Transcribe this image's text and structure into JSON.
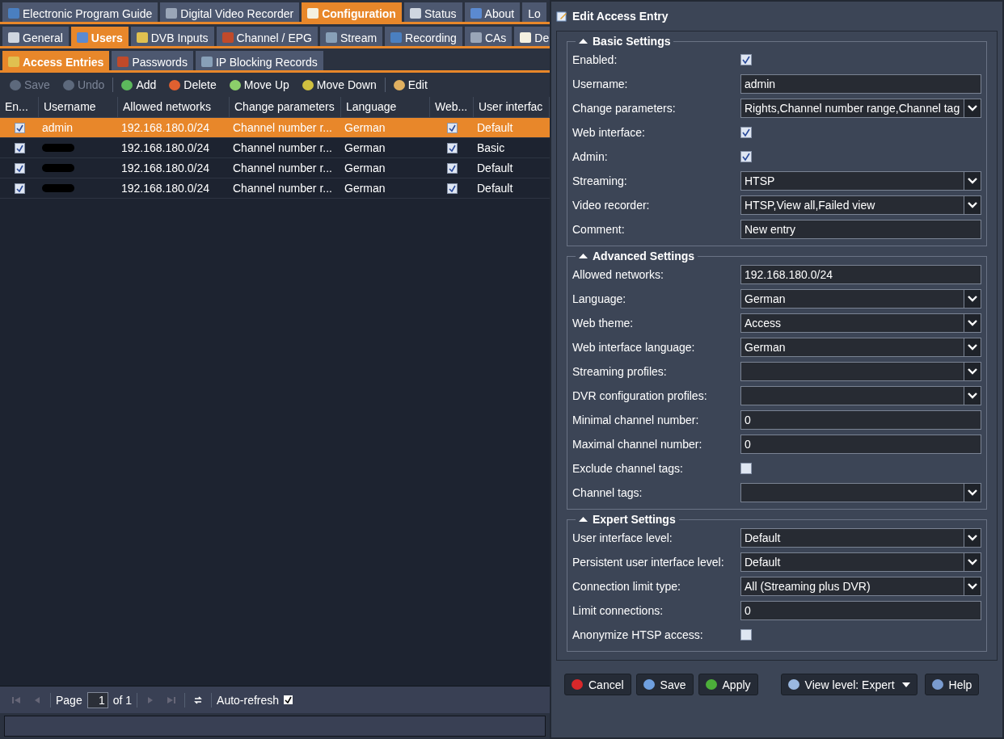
{
  "main_tabs": [
    {
      "label": "Electronic Program Guide",
      "selected": false
    },
    {
      "label": "Digital Video Recorder",
      "selected": false
    },
    {
      "label": "Configuration",
      "selected": true
    },
    {
      "label": "Status",
      "selected": false
    },
    {
      "label": "About",
      "selected": false
    },
    {
      "label": "Lo",
      "selected": false
    }
  ],
  "sub_tabs": [
    {
      "label": "General",
      "selected": false
    },
    {
      "label": "Users",
      "selected": true
    },
    {
      "label": "DVB Inputs",
      "selected": false
    },
    {
      "label": "Channel / EPG",
      "selected": false
    },
    {
      "label": "Stream",
      "selected": false
    },
    {
      "label": "Recording",
      "selected": false
    },
    {
      "label": "CAs",
      "selected": false
    },
    {
      "label": "De",
      "selected": false
    }
  ],
  "user_tabs": [
    {
      "label": "Access Entries",
      "selected": true
    },
    {
      "label": "Passwords",
      "selected": false
    },
    {
      "label": "IP Blocking Records",
      "selected": false
    }
  ],
  "toolbar": [
    {
      "label": "Save",
      "disabled": true
    },
    {
      "label": "Undo",
      "disabled": true
    },
    {
      "label": "Add",
      "disabled": false
    },
    {
      "label": "Delete",
      "disabled": false
    },
    {
      "label": "Move Up",
      "disabled": false
    },
    {
      "label": "Move Down",
      "disabled": false
    },
    {
      "label": "Edit",
      "disabled": false
    }
  ],
  "table": {
    "columns": [
      "En...",
      "Username",
      "Allowed networks",
      "Change parameters",
      "Language",
      "Web...",
      "User interfac"
    ],
    "rows": [
      {
        "selected": true,
        "enabled": true,
        "username": "admin",
        "redacted": false,
        "networks": "192.168.180.0/24",
        "change": "Channel number r...",
        "language": "German",
        "web": true,
        "ui": "Default"
      },
      {
        "selected": false,
        "enabled": true,
        "redacted": true,
        "networks": "192.168.180.0/24",
        "change": "Channel number r...",
        "language": "German",
        "web": true,
        "ui": "Basic"
      },
      {
        "selected": false,
        "enabled": true,
        "redacted": true,
        "networks": "192.168.180.0/24",
        "change": "Channel number r...",
        "language": "German",
        "web": true,
        "ui": "Default"
      },
      {
        "selected": false,
        "enabled": true,
        "redacted": true,
        "networks": "192.168.180.0/24",
        "change": "Channel number r...",
        "language": "German",
        "web": true,
        "ui": "Default"
      }
    ]
  },
  "paging": {
    "page_label": "Page",
    "page": "1",
    "of": "of 1",
    "auto_refresh": "Auto-refresh",
    "auto_refresh_checked": true
  },
  "dialog": {
    "title": "Edit Access Entry",
    "sections": [
      {
        "title": "Basic Settings",
        "fields": [
          {
            "label": "Enabled:",
            "kind": "checkbox",
            "checked": true
          },
          {
            "label": "Username:",
            "kind": "text",
            "value": "admin"
          },
          {
            "label": "Change parameters:",
            "kind": "combo",
            "value": "Rights,Channel number range,Channel tag"
          },
          {
            "label": "Web interface:",
            "kind": "checkbox",
            "checked": true
          },
          {
            "label": "Admin:",
            "kind": "checkbox",
            "checked": true
          },
          {
            "label": "Streaming:",
            "kind": "combo",
            "value": "HTSP"
          },
          {
            "label": "Video recorder:",
            "kind": "combo",
            "value": "HTSP,View all,Failed view"
          },
          {
            "label": "Comment:",
            "kind": "text",
            "value": "New entry"
          }
        ]
      },
      {
        "title": "Advanced Settings",
        "fields": [
          {
            "label": "Allowed networks:",
            "kind": "text",
            "value": "192.168.180.0/24"
          },
          {
            "label": "Language:",
            "kind": "combo",
            "value": "German"
          },
          {
            "label": "Web theme:",
            "kind": "combo",
            "value": "Access"
          },
          {
            "label": "Web interface language:",
            "kind": "combo",
            "value": "German"
          },
          {
            "label": "Streaming profiles:",
            "kind": "combo"
          },
          {
            "label": "DVR configuration profiles:",
            "kind": "combo"
          },
          {
            "label": "Minimal channel number:",
            "kind": "text",
            "value": "0"
          },
          {
            "label": "Maximal channel number:",
            "kind": "text",
            "value": "0"
          },
          {
            "label": "Exclude channel tags:",
            "kind": "checkbox",
            "checked": false
          },
          {
            "label": "Channel tags:",
            "kind": "combo"
          }
        ]
      },
      {
        "title": "Expert Settings",
        "fields": [
          {
            "label": "User interface level:",
            "kind": "combo",
            "value": "Default"
          },
          {
            "label": "Persistent user interface level:",
            "kind": "combo",
            "value": "Default"
          },
          {
            "label": "Connection limit type:",
            "kind": "combo",
            "value": "All (Streaming plus DVR)"
          },
          {
            "label": "Limit connections:",
            "kind": "text",
            "value": "0"
          },
          {
            "label": "Anonymize HTSP access:",
            "kind": "checkbox",
            "checked": false
          }
        ]
      }
    ],
    "buttons": [
      {
        "label": "Cancel",
        "kind": "cancel"
      },
      {
        "label": "Save",
        "kind": "save"
      },
      {
        "label": "Apply",
        "kind": "apply"
      },
      {
        "label": "View level: Expert",
        "kind": "menu"
      },
      {
        "label": "Help",
        "kind": "help"
      }
    ]
  }
}
